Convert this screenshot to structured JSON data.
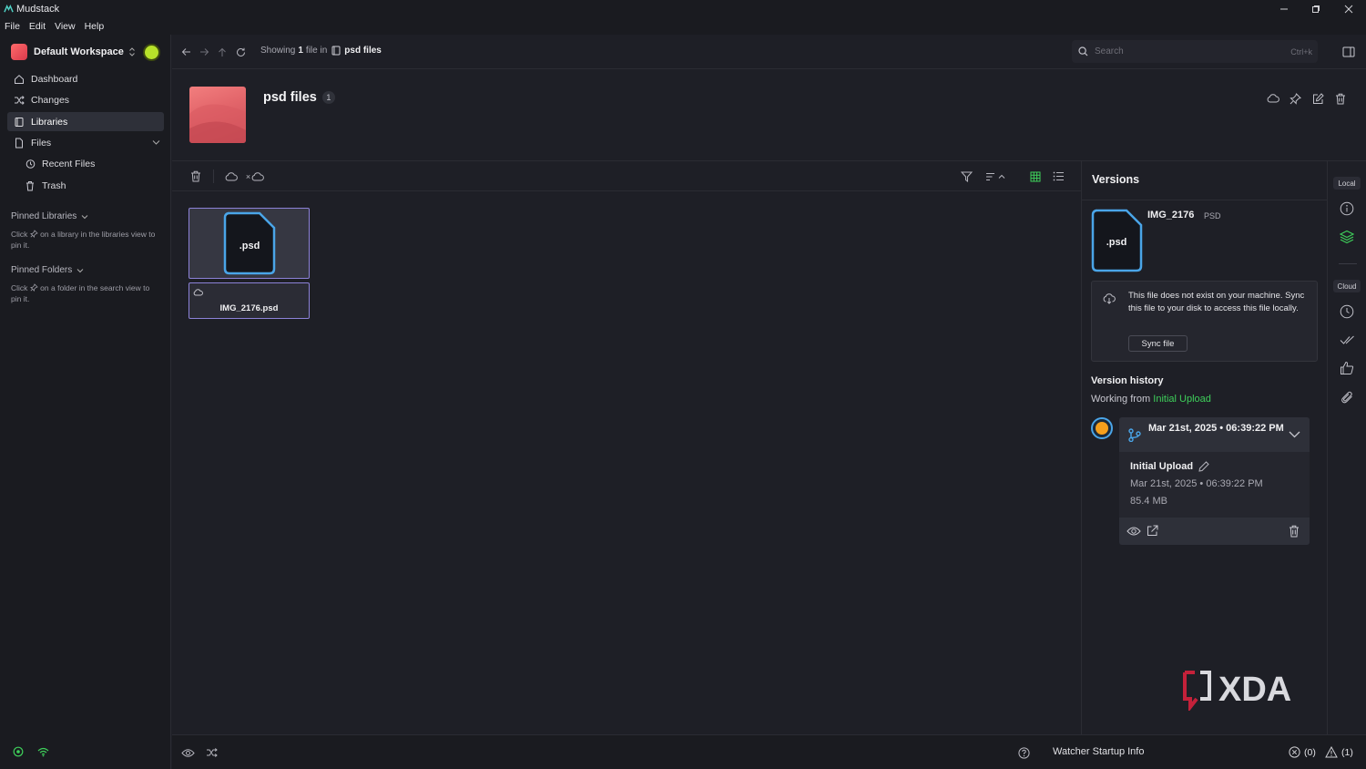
{
  "app": {
    "title": "Mudstack"
  },
  "menu": [
    "File",
    "Edit",
    "View",
    "Help"
  ],
  "sidebar": {
    "workspace": "Default Workspace",
    "nav": [
      {
        "label": "Dashboard",
        "icon": "home-icon"
      },
      {
        "label": "Changes",
        "icon": "shuffle-icon"
      },
      {
        "label": "Libraries",
        "icon": "library-icon",
        "active": true
      },
      {
        "label": "Files",
        "icon": "file-icon"
      }
    ],
    "files_sub": [
      {
        "label": "Recent Files",
        "icon": "history-icon"
      },
      {
        "label": "Trash",
        "icon": "trash-icon"
      }
    ],
    "pinned_libraries": {
      "title": "Pinned Libraries",
      "note_before": "Click",
      "note_after": "on a library in the libraries view to pin it."
    },
    "pinned_folders": {
      "title": "Pinned Folders",
      "note_before": "Click",
      "note_after": "on a folder in the search view to pin it."
    }
  },
  "topbar": {
    "showing_prefix": "Showing",
    "showing_count": "1",
    "showing_suffix": "file in",
    "folder": "psd files",
    "search_placeholder": "Search",
    "search_shortcut": "Ctrl+k"
  },
  "library": {
    "title": "psd files",
    "count": "1"
  },
  "toolbar": {
    "offline_marker": "×"
  },
  "files": [
    {
      "ext": ".psd",
      "name": "IMG_2176.psd"
    }
  ],
  "versions": {
    "title": "Versions",
    "file_ext": ".psd",
    "file_name": "IMG_2176",
    "file_type": "PSD",
    "notice": "This file does not exist on your machine. Sync this file to your disk to access this file locally.",
    "sync_button": "Sync file",
    "history_title": "Version history",
    "working_prefix": "Working from",
    "working_version": "Initial Upload",
    "entry": {
      "date_header": "Mar 21st, 2025 • 06:39:22 PM",
      "name": "Initial Upload",
      "date": "Mar 21st, 2025 • 06:39:22 PM",
      "size": "85.4 MB"
    }
  },
  "rail": {
    "local": "Local",
    "cloud": "Cloud"
  },
  "statusbar": {
    "watcher": "Watcher Startup Info",
    "errors": "(0)",
    "warnings": "(1)"
  },
  "watermark": "XDA",
  "colors": {
    "accent_green": "#3ecf5a",
    "selection": "#8c82d8",
    "file_icon_blue": "#4aa5e8",
    "background": "#1e1f26"
  }
}
